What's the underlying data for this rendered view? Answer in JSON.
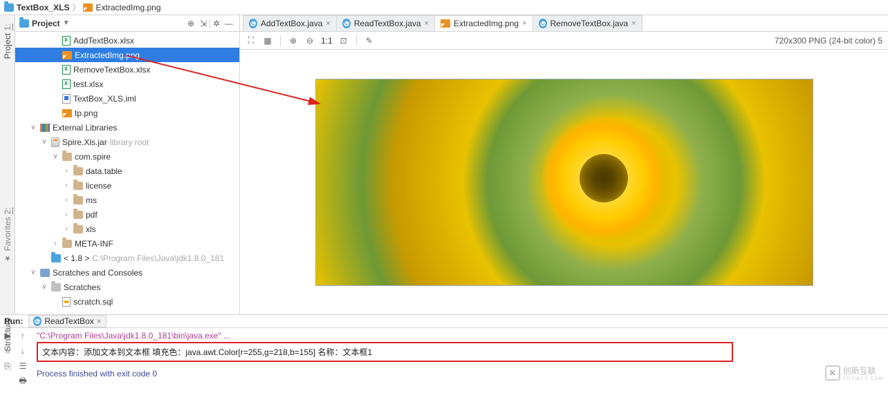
{
  "breadcrumb": {
    "root": "TextBox_XLS",
    "file": "ExtractedImg.png"
  },
  "project": {
    "title": "Project",
    "items": [
      {
        "indent": 48,
        "exp": "",
        "icon": "xls",
        "label": "AddTextBox.xlsx"
      },
      {
        "indent": 48,
        "exp": "",
        "icon": "img",
        "label": "ExtractedImg.png",
        "selected": true
      },
      {
        "indent": 48,
        "exp": "",
        "icon": "xls",
        "label": "RemoveTextBox.xlsx"
      },
      {
        "indent": 48,
        "exp": "",
        "icon": "xls",
        "label": "test.xlsx"
      },
      {
        "indent": 48,
        "exp": "",
        "icon": "iml",
        "label": "TextBox_XLS.iml"
      },
      {
        "indent": 48,
        "exp": "",
        "icon": "img",
        "label": "tp.png"
      },
      {
        "indent": 16,
        "exp": "v",
        "icon": "lib",
        "label": "External Libraries"
      },
      {
        "indent": 32,
        "exp": "v",
        "icon": "jar",
        "label": "Spire.Xls.jar",
        "faint": "library root"
      },
      {
        "indent": 48,
        "exp": "v",
        "icon": "folder-tan",
        "label": "com.spire"
      },
      {
        "indent": 64,
        "exp": ">",
        "icon": "folder-tan",
        "label": "data.table"
      },
      {
        "indent": 64,
        "exp": ">",
        "icon": "folder-tan",
        "label": "license"
      },
      {
        "indent": 64,
        "exp": ">",
        "icon": "folder-tan",
        "label": "ms"
      },
      {
        "indent": 64,
        "exp": ">",
        "icon": "folder-tan",
        "label": "pdf"
      },
      {
        "indent": 64,
        "exp": ">",
        "icon": "folder-tan",
        "label": "xls"
      },
      {
        "indent": 48,
        "exp": ">",
        "icon": "folder-tan",
        "label": "META-INF"
      },
      {
        "indent": 32,
        "exp": "",
        "icon": "folder-blue",
        "label": "< 1.8 >",
        "faint": "C:\\Program Files\\Java\\jdk1.8.0_181"
      },
      {
        "indent": 16,
        "exp": "v",
        "icon": "sc",
        "label": "Scratches and Consoles"
      },
      {
        "indent": 32,
        "exp": "v",
        "icon": "folder-gray",
        "label": "Scratches"
      },
      {
        "indent": 48,
        "exp": "",
        "icon": "sql",
        "label": "scratch.sql"
      }
    ]
  },
  "tabs": [
    {
      "icon": "java",
      "label": "AddTextBox.java",
      "active": false
    },
    {
      "icon": "java",
      "label": "ReadTextBox.java",
      "active": false
    },
    {
      "icon": "img",
      "label": "ExtractedImg.png",
      "active": true
    },
    {
      "icon": "java",
      "label": "RemoveTextBox.java",
      "active": false
    }
  ],
  "viewer": {
    "info": "720x300 PNG (24-bit color) 5",
    "ratio": "1:1"
  },
  "leftTabs": {
    "t1_num": "1:",
    "t1_label": "Project",
    "t2_num": "2:",
    "t2_label": "Favorites",
    "t3_label": "Structure"
  },
  "run": {
    "header": "Run:",
    "tab": "ReadTextBox",
    "line1": "\"C:\\Program Files\\Java\\jdk1.8.0_181\\bin\\java.exe\" ...",
    "boxed": "文本内容：添加文本到文本框 填充色：java.awt.Color[r=255,g=218,b=155] 名称：文本框1",
    "exit": "Process finished with exit code 0"
  },
  "watermark": {
    "brand": "创新互联",
    "sub": "CDXWCX.COM"
  }
}
